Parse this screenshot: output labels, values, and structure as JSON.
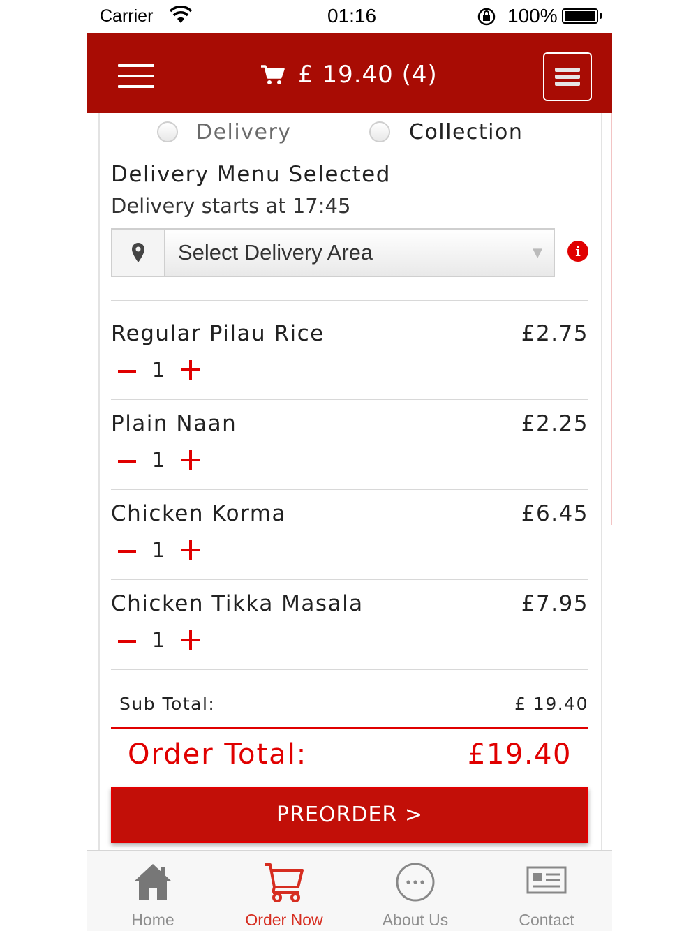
{
  "status_bar": {
    "carrier": "Carrier",
    "time": "01:16",
    "battery": "100%"
  },
  "header": {
    "cart_total": "£ 19.40 (4)"
  },
  "order_type": {
    "delivery_label": "Delivery",
    "collection_label": "Collection"
  },
  "menu_selected": "Delivery Menu Selected",
  "delivery_starts": "Delivery starts at 17:45",
  "delivery_area": {
    "placeholder": "Select Delivery Area"
  },
  "items": [
    {
      "name": "Regular Pilau Rice",
      "price": "£2.75",
      "qty": "1"
    },
    {
      "name": "Plain Naan",
      "price": "£2.25",
      "qty": "1"
    },
    {
      "name": "Chicken Korma",
      "price": "£6.45",
      "qty": "1"
    },
    {
      "name": "Chicken Tikka Masala",
      "price": "£7.95",
      "qty": "1"
    }
  ],
  "totals": {
    "subtotal_label": "Sub Total:",
    "subtotal_value": "£ 19.40",
    "order_total_label": "Order Total:",
    "order_total_value": "£19.40"
  },
  "preorder_label": "PREORDER >",
  "tabs": [
    {
      "label": "Home",
      "icon": "home-icon"
    },
    {
      "label": "Order Now",
      "icon": "cart-icon",
      "active": true
    },
    {
      "label": "About Us",
      "icon": "more-icon"
    },
    {
      "label": "Contact",
      "icon": "contact-card-icon"
    }
  ],
  "colors": {
    "brand": "#a80c04",
    "accent": "#e00000",
    "button": "#c20f08"
  }
}
